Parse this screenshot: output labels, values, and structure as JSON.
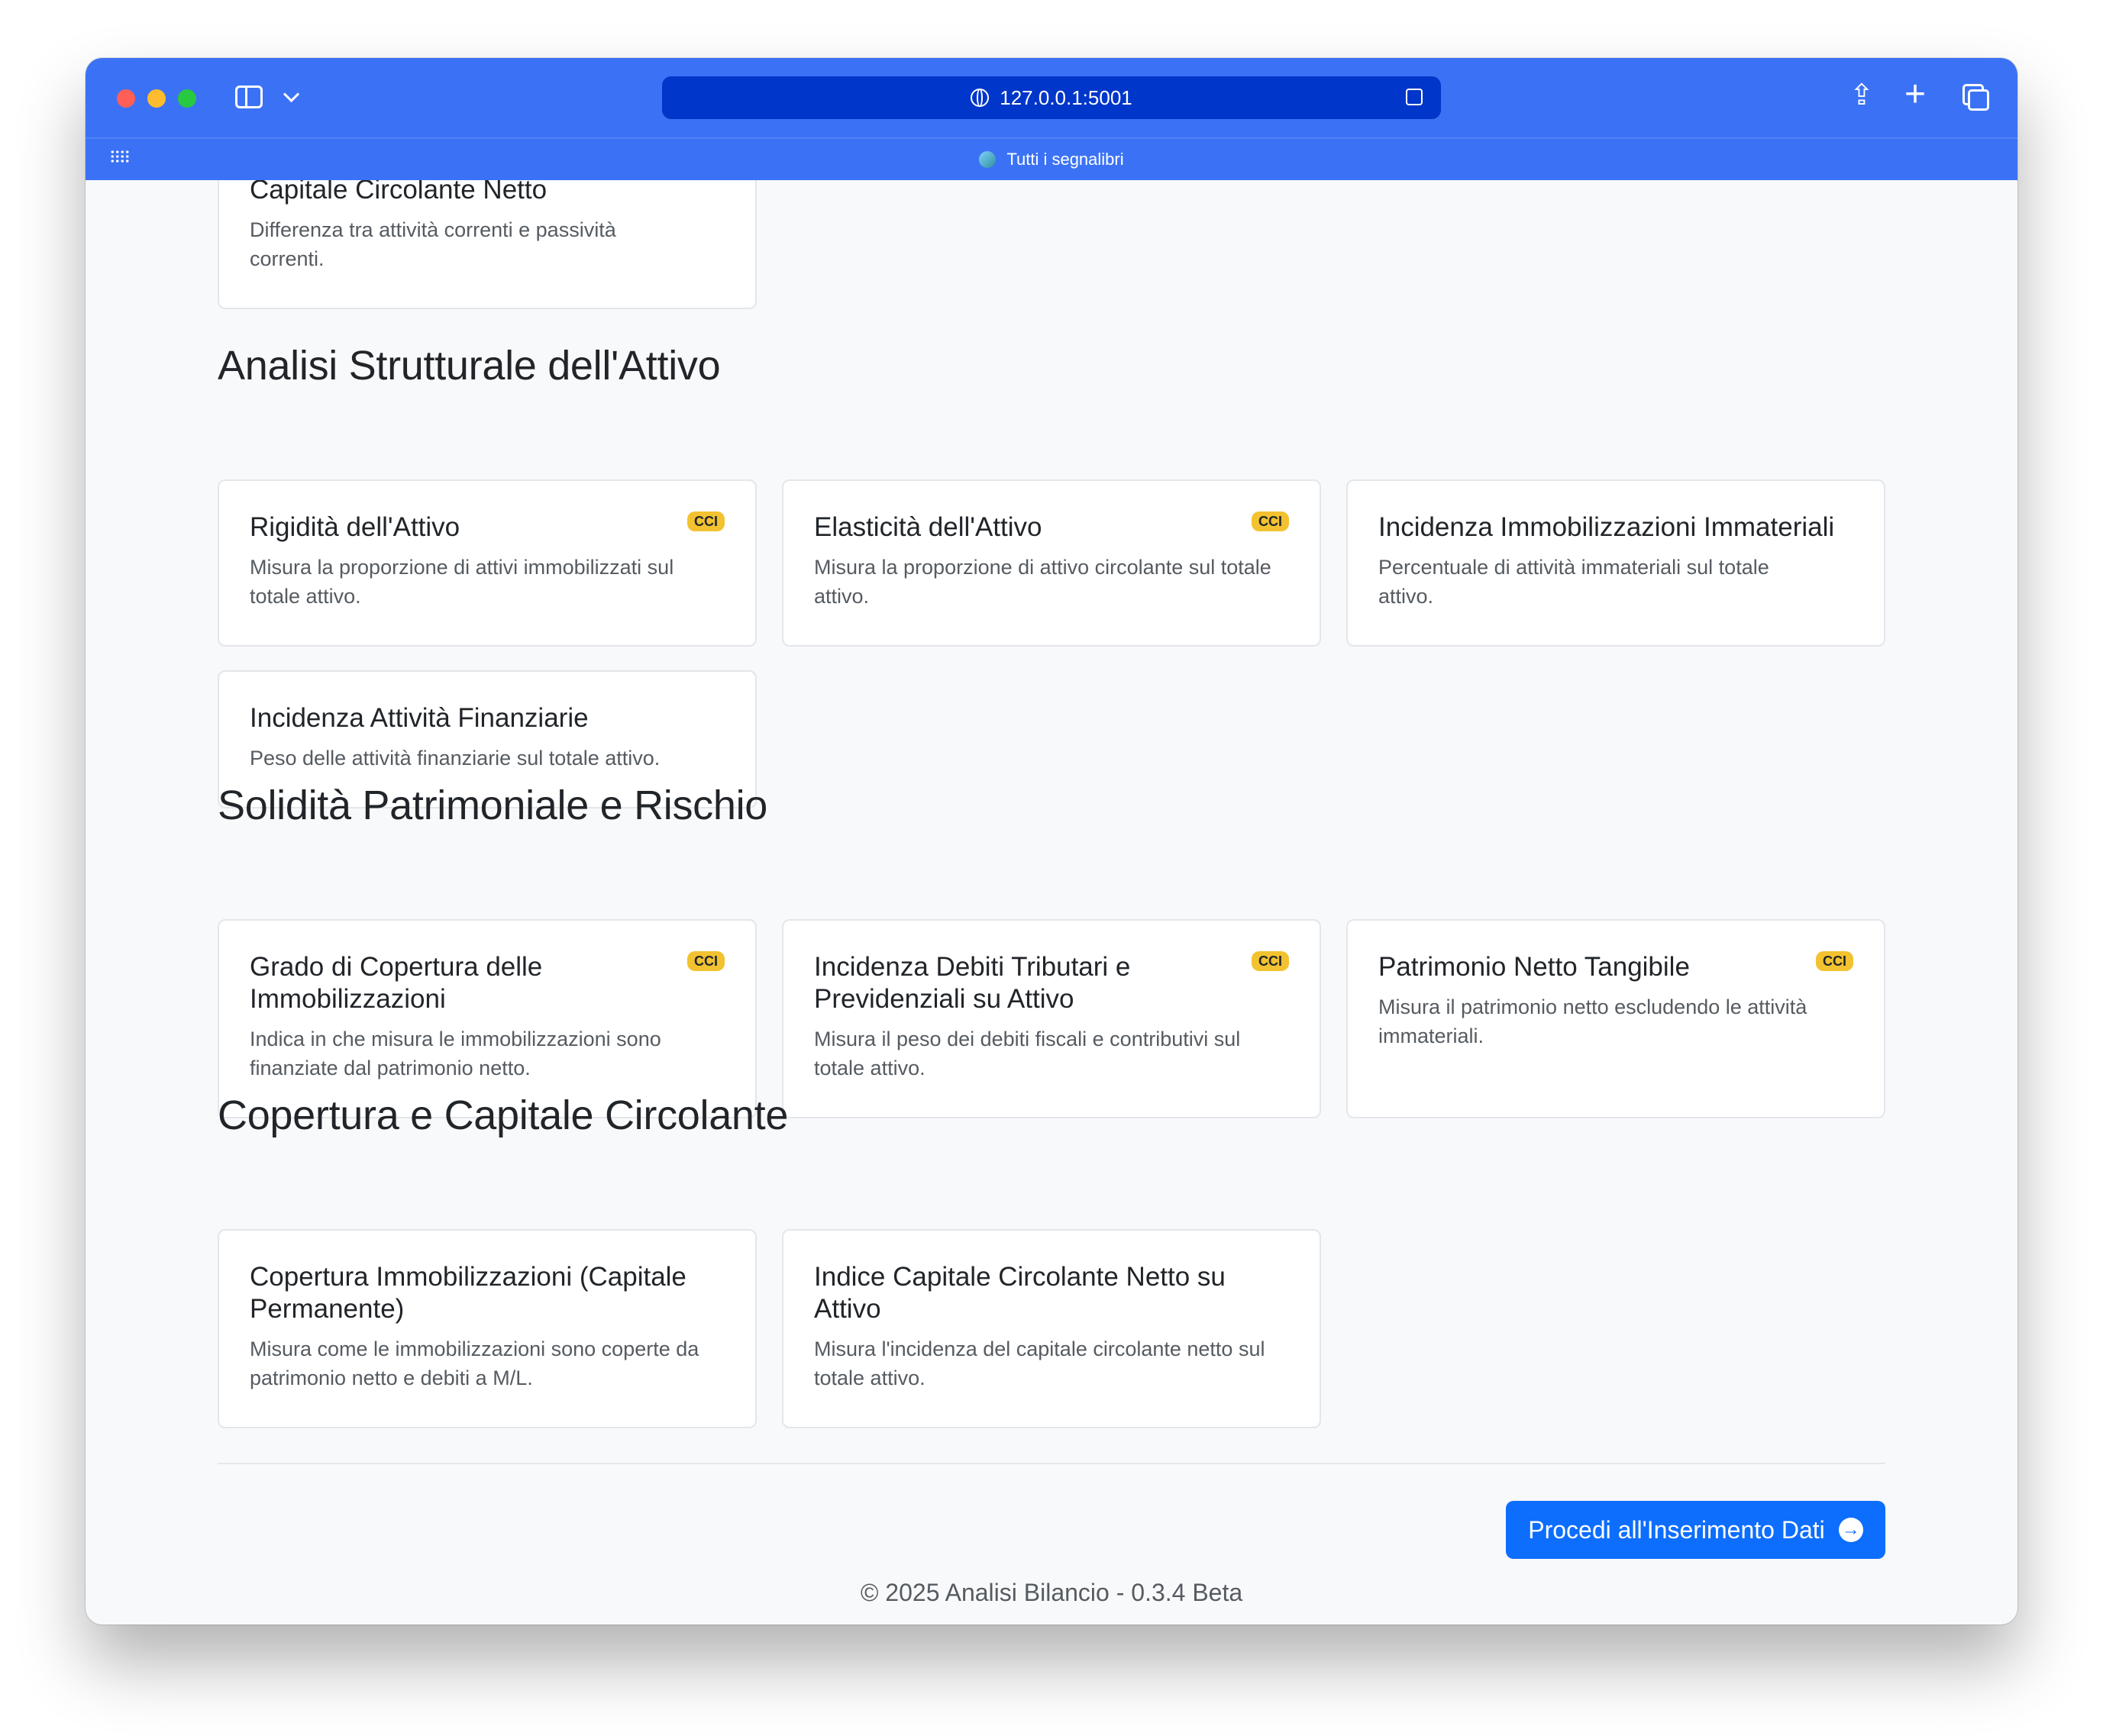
{
  "browser": {
    "url": "127.0.0.1:5001",
    "bookmarks_label": "Tutti i segnalibri"
  },
  "top_card": {
    "title": "Capitale Circolante Netto",
    "description": "Differenza tra attività correnti e passività correnti."
  },
  "sections": [
    {
      "title": "Analisi Strutturale dell'Attivo",
      "cards": [
        {
          "title": "Rigidità dell'Attivo",
          "badge": "CCI",
          "description": "Misura la proporzione di attivi immobilizzati sul totale attivo."
        },
        {
          "title": "Elasticità dell'Attivo",
          "badge": "CCI",
          "description": "Misura la proporzione di attivo circolante sul totale attivo."
        },
        {
          "title": "Incidenza Immobilizzazioni Immateriali",
          "description": "Percentuale di attività immateriali sul totale attivo."
        },
        {
          "title": "Incidenza Attività Finanziarie",
          "description": "Peso delle attività finanziarie sul totale attivo."
        }
      ]
    },
    {
      "title": "Solidità Patrimoniale e Rischio",
      "cards": [
        {
          "title": "Grado di Copertura delle Immobilizzazioni",
          "badge": "CCI",
          "description": "Indica in che misura le immobilizzazioni sono finanziate dal patrimonio netto."
        },
        {
          "title": "Incidenza Debiti Tributari e Previdenziali su Attivo",
          "badge": "CCI",
          "description": "Misura il peso dei debiti fiscali e contributivi sul totale attivo."
        },
        {
          "title": "Patrimonio Netto Tangibile",
          "badge": "CCI",
          "description": "Misura il patrimonio netto escludendo le attività immateriali."
        }
      ]
    },
    {
      "title": "Copertura e Capitale Circolante",
      "cards": [
        {
          "title": "Copertura Immobilizzazioni (Capitale Permanente)",
          "description": "Misura come le immobilizzazioni sono coperte da patrimonio netto e debiti a M/L."
        },
        {
          "title": "Indice Capitale Circolante Netto su Attivo",
          "description": "Misura l'incidenza del capitale circolante netto sul totale attivo."
        }
      ]
    }
  ],
  "cta": {
    "label": "Procedi all'Inserimento Dati",
    "icon": "arrow-right-circle-icon"
  },
  "footer": {
    "text": "© 2025 Analisi Bilancio - 0.3.4 Beta"
  },
  "colors": {
    "titlebar": "#3b72f5",
    "urlbar": "#0036c9",
    "primary": "#0d6efd",
    "badge": "#f2c230"
  }
}
